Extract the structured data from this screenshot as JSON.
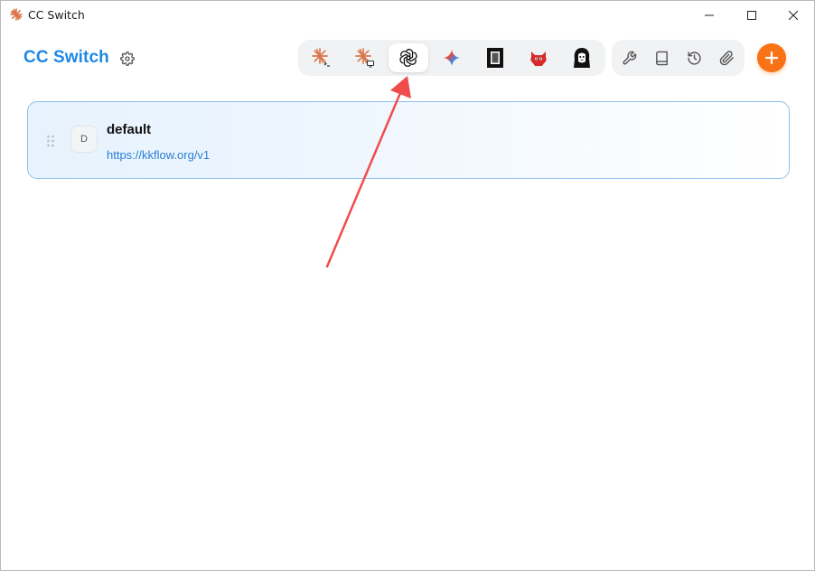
{
  "window": {
    "title": "CC Switch",
    "controls": [
      "minimize",
      "maximize",
      "close"
    ]
  },
  "header": {
    "app_title": "CC Switch",
    "settings_icon": "gear-icon",
    "add_icon": "plus-icon",
    "accent_color": "#1e88e5",
    "add_button_color": "#f97316"
  },
  "app_switcher": {
    "tabs": [
      {
        "id": "claude-code",
        "icon": "claude-terminal-icon",
        "active": false
      },
      {
        "id": "claude-desktop",
        "icon": "claude-desktop-icon",
        "active": false
      },
      {
        "id": "codex",
        "icon": "openai-icon",
        "active": true
      },
      {
        "id": "gemini",
        "icon": "gemini-icon",
        "active": false
      },
      {
        "id": "opencode",
        "icon": "opencode-icon",
        "active": false
      },
      {
        "id": "red-app",
        "icon": "red-mascot-icon",
        "active": false
      },
      {
        "id": "avatar-app",
        "icon": "hooded-figure-icon",
        "active": false
      }
    ]
  },
  "tools": [
    {
      "id": "tools",
      "icon": "wrench-icon"
    },
    {
      "id": "docs",
      "icon": "book-icon"
    },
    {
      "id": "history",
      "icon": "history-icon"
    },
    {
      "id": "attachments",
      "icon": "paperclip-icon"
    }
  ],
  "providers": [
    {
      "initial": "D",
      "name": "default",
      "url": "https://kkflow.org/v1",
      "selected": true
    }
  ],
  "annotation": {
    "type": "arrow",
    "color": "#f04c4c",
    "target": "codex tab"
  }
}
